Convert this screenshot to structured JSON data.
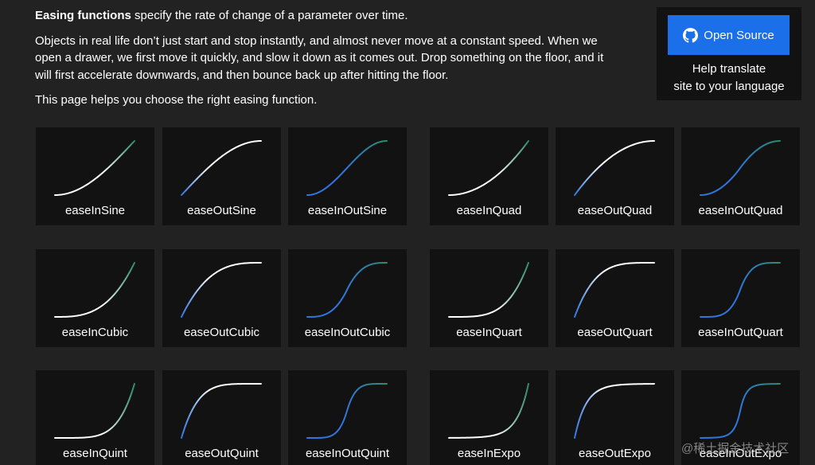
{
  "intro": {
    "bold_lead": "Easing functions",
    "lead_rest": " specify the rate of change of a parameter over time.",
    "paragraph2": "Objects in real life don’t just start and stop instantly, and almost never move at a constant speed. When we open a drawer, we first move it quickly, and slow it down as it comes out. Drop something on the floor, and it will first accelerate downwards, and then bounce back up after hitting the floor.",
    "paragraph3": "This page helps you choose the right easing function."
  },
  "open_source": {
    "button_label": "Open Source",
    "help_line1": "Help translate",
    "help_line2": "site to your language"
  },
  "colors": {
    "accent_blue": "#2f76e0",
    "accent_green": "#2e8b6a",
    "curve_white": "#ffffff"
  },
  "easings": [
    {
      "name": "easeInSine"
    },
    {
      "name": "easeOutSine"
    },
    {
      "name": "easeInOutSine"
    },
    {
      "name": "easeInQuad"
    },
    {
      "name": "easeOutQuad"
    },
    {
      "name": "easeInOutQuad"
    },
    {
      "name": "easeInCubic"
    },
    {
      "name": "easeOutCubic"
    },
    {
      "name": "easeInOutCubic"
    },
    {
      "name": "easeInQuart"
    },
    {
      "name": "easeOutQuart"
    },
    {
      "name": "easeInOutQuart"
    },
    {
      "name": "easeInQuint"
    },
    {
      "name": "easeOutQuint"
    },
    {
      "name": "easeInOutQuint"
    },
    {
      "name": "easeInExpo"
    },
    {
      "name": "easeOutExpo"
    },
    {
      "name": "easeInOutExpo"
    }
  ],
  "watermark": "@稀土掘金技术社区"
}
